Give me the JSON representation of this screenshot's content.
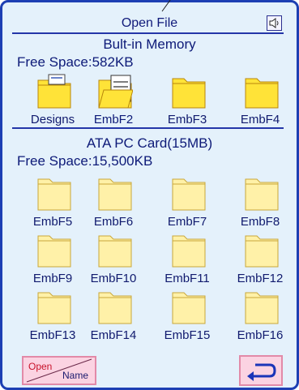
{
  "title": "Open File",
  "builtin": {
    "heading": "Bult-in Memory",
    "free_space": "Free Space:582KB"
  },
  "builtin_items": [
    {
      "label": "Designs",
      "icon": "folder-open-icon"
    },
    {
      "label": "EmbF2",
      "icon": "folder-open-document-icon"
    },
    {
      "label": "EmbF3",
      "icon": "folder-icon"
    },
    {
      "label": "EmbF4",
      "icon": "folder-icon"
    }
  ],
  "card": {
    "heading": "ATA PC Card(15MB)",
    "free_space": "Free Space:15,500KB"
  },
  "card_items": [
    {
      "label": "EmbF5"
    },
    {
      "label": "EmbF6"
    },
    {
      "label": "EmbF7"
    },
    {
      "label": "EmbF8"
    },
    {
      "label": "EmbF9"
    },
    {
      "label": "EmbF10"
    },
    {
      "label": "EmbF11"
    },
    {
      "label": "EmbF12"
    },
    {
      "label": "EmbF13"
    },
    {
      "label": "EmbF14"
    },
    {
      "label": "EmbF15"
    },
    {
      "label": "EmbF16"
    }
  ],
  "buttons": {
    "open_label": "Open",
    "name_label": "Name"
  },
  "colors": {
    "accent": "#1d3fb3",
    "folder_yellow": "#ffe338",
    "folder_pale": "#fff1a8",
    "button_pink": "#fbd3e2"
  }
}
